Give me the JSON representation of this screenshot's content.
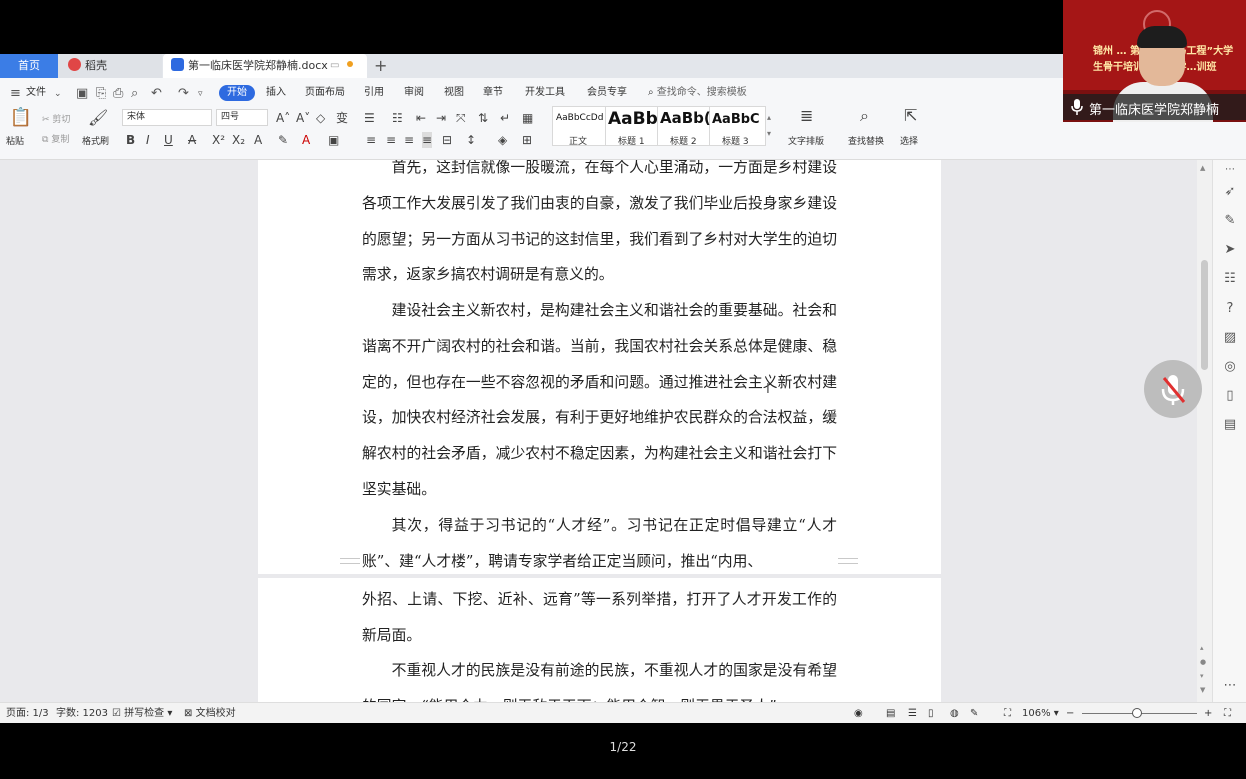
{
  "tabs": {
    "home": "首页",
    "daoke": "稻壳",
    "document": "第一临床医学院郑静楠.docx",
    "add": "+"
  },
  "menu": {
    "file": "文件",
    "items": [
      "开始",
      "插入",
      "页面布局",
      "引用",
      "审阅",
      "视图",
      "章节",
      "开发工具",
      "会员专享"
    ],
    "search_placeholder": "查找命令、搜索模板"
  },
  "ribbon": {
    "paste": "粘贴",
    "cut": "剪切",
    "copy": "复制",
    "format_painter": "格式刷",
    "font_name": "宋体",
    "font_size": "四号",
    "styles": [
      {
        "sample": "AaBbCcDd",
        "name": "正文"
      },
      {
        "sample": "AaBb",
        "name": "标题 1"
      },
      {
        "sample": "AaBb(",
        "name": "标题 2"
      },
      {
        "sample": "AaBbC",
        "name": "标题 3"
      }
    ],
    "text_layout": "文字排版",
    "find_replace": "查找替换",
    "select": "选择"
  },
  "document": {
    "page1_paragraphs": [
      "首先，这封信就像一股暖流，在每个人心里涌动，一方面是乡村建设各项工作大发展引发了我们由衷的自豪，激发了我们毕业后投身家乡建设的愿望；另一方面从习书记的这封信里，我们看到了乡村对大学生的迫切需求，返家乡搞农村调研是有意义的。",
      "建设社会主义新农村，是构建社会主义和谐社会的重要基础。社会和谐离不开广阔农村的社会和谐。当前，我国农村社会关系总体是健康、稳定的，但也存在一些不容忽视的矛盾和问题。通过推进社会主义新农村建设，加快农村经济社会发展，有利于更好地维护农民群众的合法权益，缓解农村的社会矛盾，减少农村不稳定因素，为构建社会主义和谐社会打下坚实基础。",
      "其次，得益于习书记的“人才经”。习书记在正定时倡导建立“人才账”、建“人才楼”，聘请专家学者给正定当顾问，推出“内用、"
    ],
    "page2_paragraphs": [
      "外招、上请、下挖、近补、远育”等一系列举措，打开了人才开发工作的新局面。",
      "不重视人才的民族是没有前途的民族，不重视人才的国家是没有希望的国家。“能用众力，则无敌于天下；能用众智，则无畏于圣人”"
    ]
  },
  "status": {
    "page": "页面: 1/3",
    "word_count": "字数: 1203",
    "spell_check": "拼写检查",
    "doc_proof": "文档校对",
    "zoom": "106%"
  },
  "player": {
    "slide_counter": "1/22"
  },
  "webcam": {
    "banner_text": "锦州 … 第六期“青马工程”大学生骨干培训班 暨团学…训班",
    "participant_name": "第一临床医学院郑静楠"
  }
}
